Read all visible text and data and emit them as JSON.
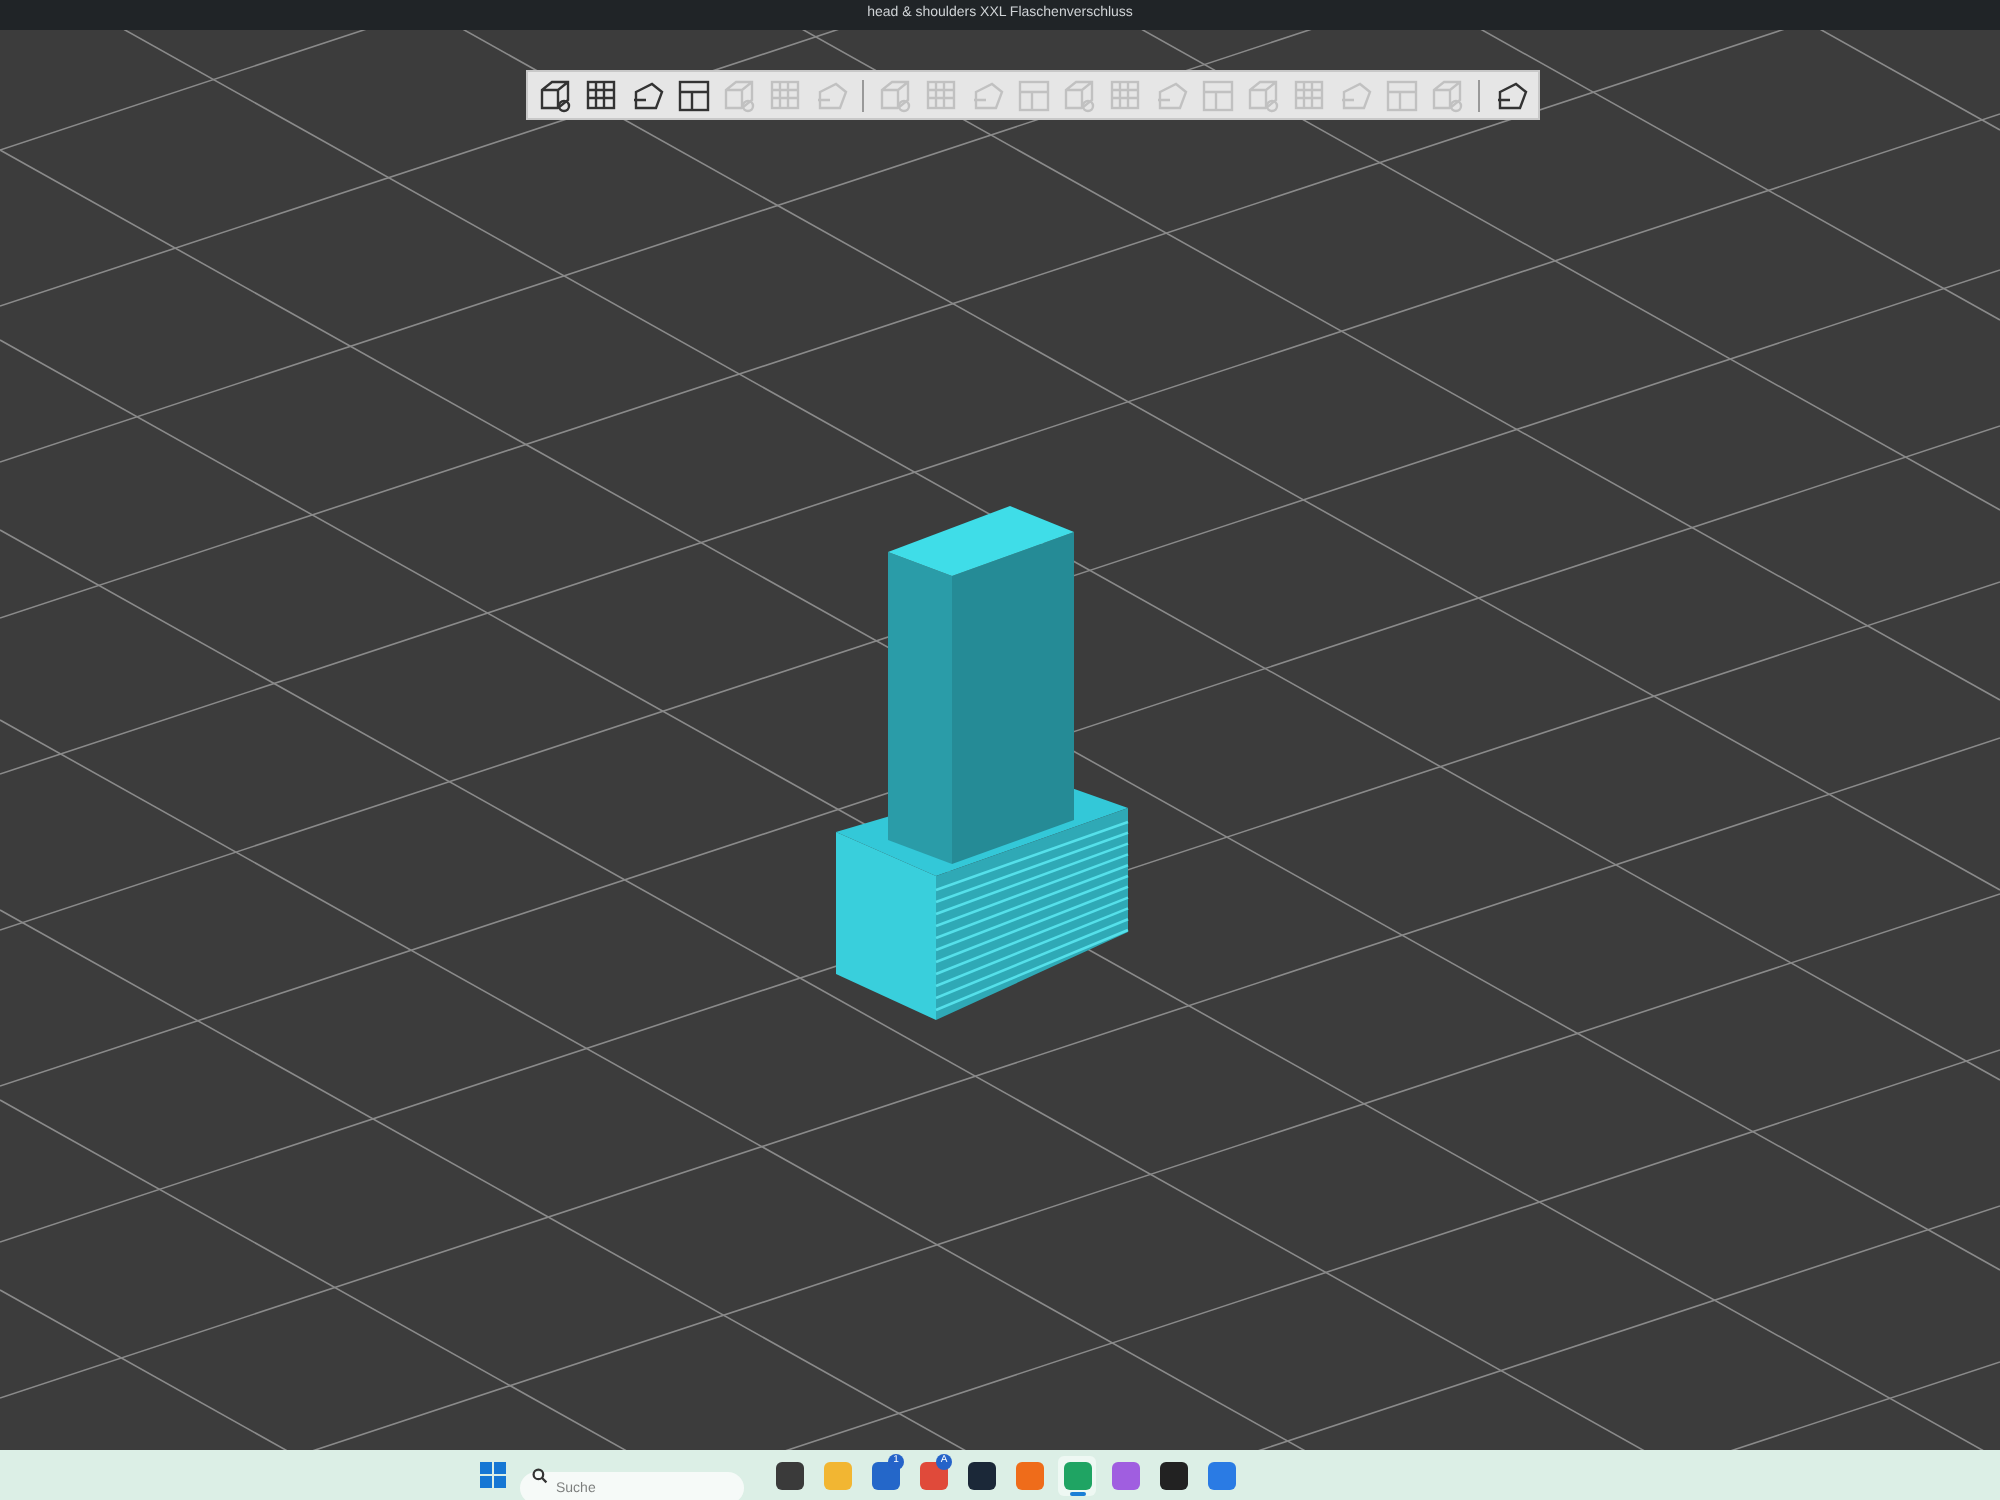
{
  "window": {
    "title": "head & shoulders XXL Flaschenverschluss"
  },
  "toolbar": {
    "groups": [
      [
        {
          "disabled": false
        },
        {
          "disabled": false
        },
        {
          "disabled": false
        },
        {
          "disabled": false
        },
        {
          "disabled": true
        },
        {
          "disabled": true
        },
        {
          "disabled": true
        }
      ],
      [
        {
          "disabled": true
        },
        {
          "disabled": true
        },
        {
          "disabled": true
        },
        {
          "disabled": true
        },
        {
          "disabled": true
        },
        {
          "disabled": true
        },
        {
          "disabled": true
        },
        {
          "disabled": true
        },
        {
          "disabled": true
        },
        {
          "disabled": true
        },
        {
          "disabled": true
        },
        {
          "disabled": true
        },
        {
          "disabled": true
        }
      ],
      [
        {
          "disabled": false
        }
      ]
    ]
  },
  "taskbar": {
    "search": {
      "placeholder": "Suche"
    },
    "apps": [
      {
        "selected": false
      },
      {
        "selected": false
      },
      {
        "selected": false,
        "badge": "1"
      },
      {
        "selected": false,
        "badge": "A"
      },
      {
        "selected": false
      },
      {
        "selected": false
      },
      {
        "selected": true
      },
      {
        "selected": false
      },
      {
        "selected": false
      },
      {
        "selected": false
      }
    ]
  }
}
